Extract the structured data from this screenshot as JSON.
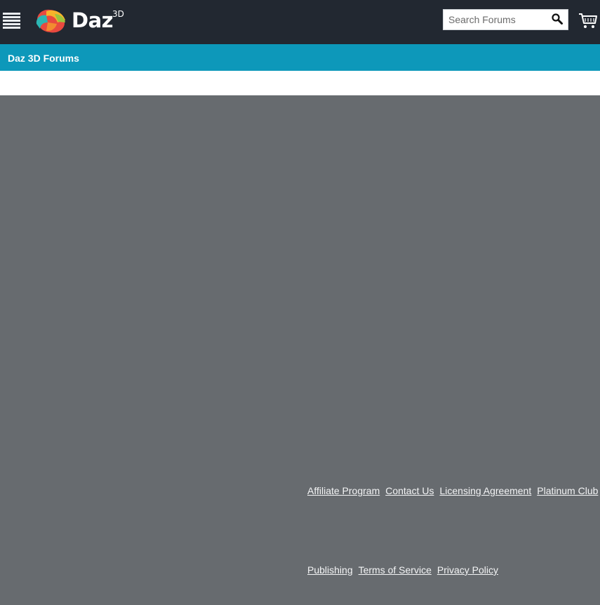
{
  "header": {
    "brand": "Daz",
    "brand_sup": "3D",
    "search": {
      "placeholder": "Search Forums",
      "value": ""
    },
    "icons": {
      "menu": "hamburger-menu-icon",
      "search": "search-icon",
      "cart": "cart-icon"
    }
  },
  "forum_bar": {
    "title": "Daz 3D Forums"
  },
  "footer": {
    "row1": [
      "Affiliate Program",
      "Contact Us",
      "Licensing Agreement",
      "Platinum Club"
    ],
    "row2": [
      "Publishing",
      "Terms of Service",
      "Privacy Policy"
    ]
  },
  "colors": {
    "topbar": "#222831",
    "forum_bar": "#0d98ba",
    "page_background": "#676b6f",
    "footer_link": "#f3f4f5"
  }
}
